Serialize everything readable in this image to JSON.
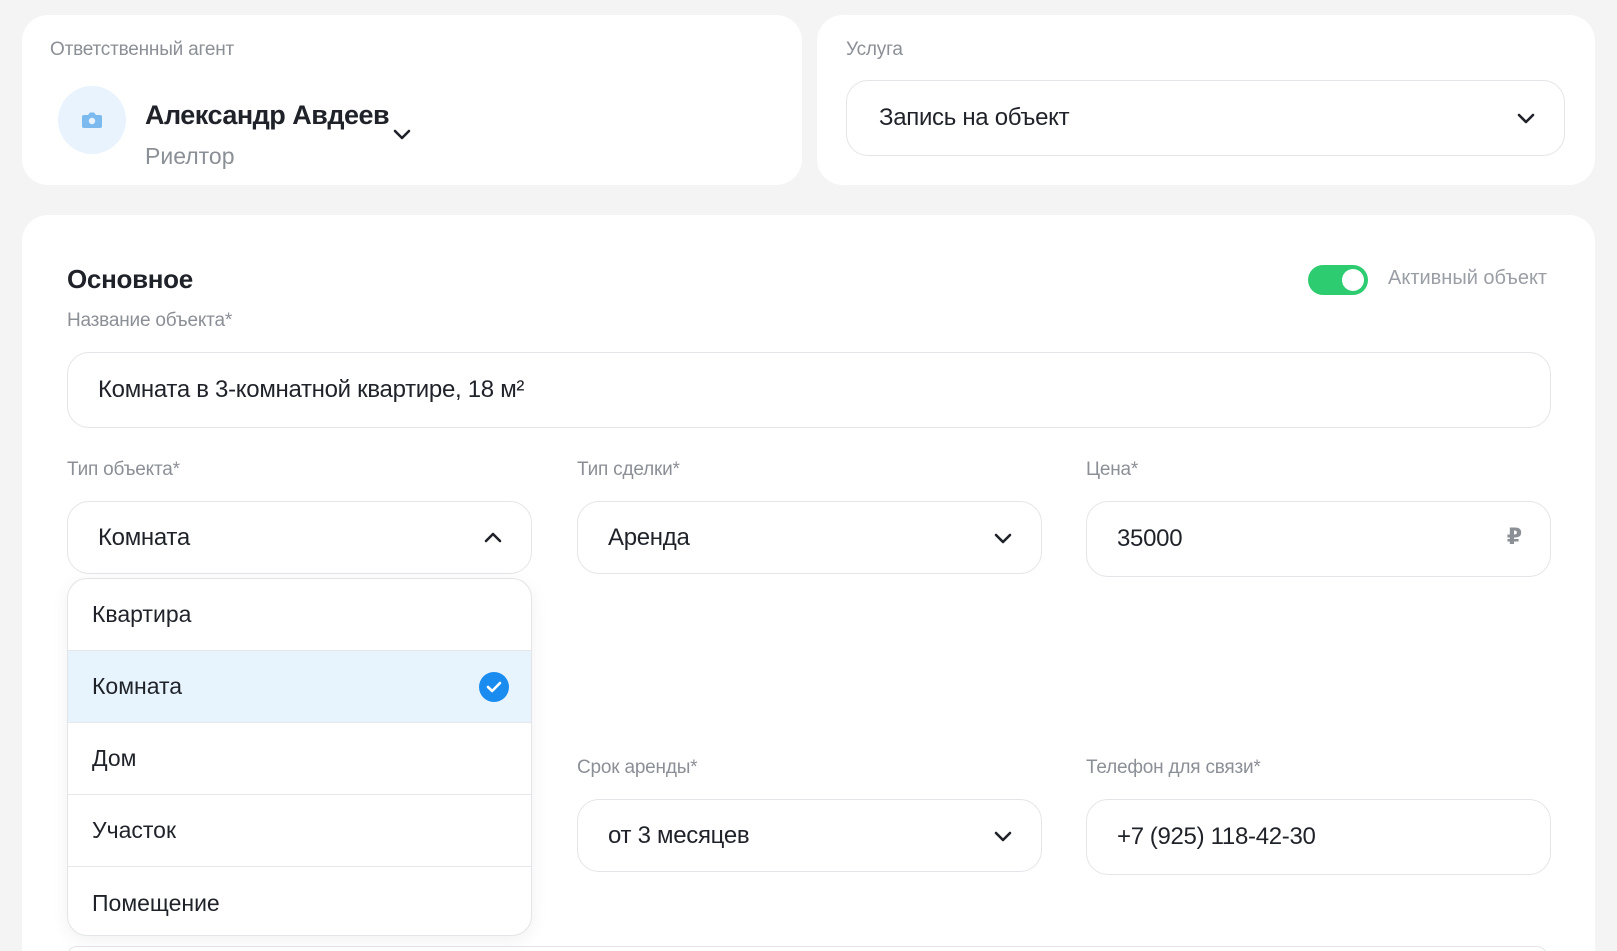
{
  "agent": {
    "caption": "Ответственный агент",
    "name": "Александр Авдеев",
    "role": "Риелтор"
  },
  "service": {
    "caption": "Услуга",
    "value": "Запись на объект"
  },
  "main": {
    "section_title": "Основное",
    "active_toggle": {
      "label": "Активный объект",
      "on": true,
      "color": "#2ecc71"
    },
    "name_field": {
      "label": "Название объекта*",
      "value": "Комната в 3-комнатной квартире, 18 м²"
    },
    "object_type": {
      "label": "Тип объекта*",
      "value": "Комната",
      "expanded": true,
      "options": [
        "Квартира",
        "Комната",
        "Дом",
        "Участок",
        "Помещение"
      ],
      "selected": "Комната"
    },
    "deal_type": {
      "label": "Тип сделки*",
      "value": "Аренда"
    },
    "price": {
      "label": "Цена*",
      "value": "35000",
      "currency": "₽"
    },
    "rent_term": {
      "label": "Срок аренды*",
      "value": "от 3 месяцев"
    },
    "phone": {
      "label": "Телефон для связи*",
      "prefix": "+7",
      "value": "(925) 118-42-30"
    }
  },
  "colors": {
    "accent_blue": "#1a8cf0",
    "selected_bg": "#e8f4fd",
    "toggle_on": "#2ecc71"
  }
}
